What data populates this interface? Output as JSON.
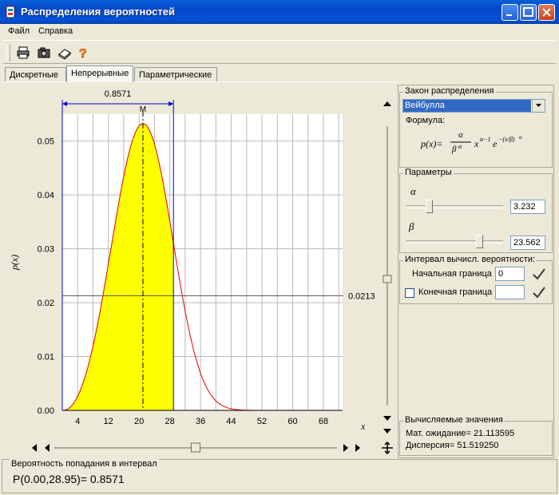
{
  "window": {
    "title": "Распределения вероятностей"
  },
  "menu": {
    "items": [
      "Файл",
      "Справка"
    ]
  },
  "toolbar": {
    "icons": [
      "printer-icon",
      "camera-icon",
      "book-icon",
      "help-icon"
    ]
  },
  "tabs": [
    {
      "label": "Дискретные",
      "active": false
    },
    {
      "label": "Непрерывные",
      "active": true
    },
    {
      "label": "Параметрические",
      "active": false
    }
  ],
  "chart": {
    "interval_width_label": "0.8571",
    "mode_label": "M",
    "ylabel": "p(x)",
    "xlabel": "x",
    "hline_label": "0.0213"
  },
  "chart_data": {
    "type": "area",
    "distribution": "weibull",
    "alpha": 3.232,
    "beta": 23.562,
    "xlim": [
      0,
      73
    ],
    "ylim": [
      0,
      0.055
    ],
    "xticks": [
      "4",
      "12",
      "20",
      "28",
      "36",
      "44",
      "52",
      "60",
      "68"
    ],
    "yticks": [
      "0.00",
      "0.01",
      "0.02",
      "0.03",
      "0.04",
      "0.05"
    ],
    "shaded_interval": [
      0.0,
      28.95
    ],
    "mode": 21.0,
    "mode_density": 0.0532,
    "hline_value": 0.0213,
    "grid": true
  },
  "panel": {
    "law_group_title": "Закон распределения",
    "law_selected": "Вейбулла",
    "formula_label": "Формула:",
    "params_group_title": "Параметры",
    "alpha_label": "α",
    "alpha_value": "3.232",
    "alpha_position": 0.22,
    "beta_label": "β",
    "beta_value": "23.562",
    "beta_position": 0.78,
    "interval_group_title": "Интервал вычисл. вероятности:",
    "start_label": "Начальная граница",
    "start_value": "0",
    "end_label": "Конечная граница",
    "end_value": "",
    "end_checked": false,
    "computed_group_title": "Вычисляемые значения",
    "mean_text": "Мат. ожидание= 21.113595",
    "variance_text": "Дисперсия= 51.519250"
  },
  "status": {
    "group_title": "Вероятность попадания в интервал",
    "result": "P(0.00,28.95)= 0.8571"
  },
  "scroll": {
    "vertical_position": 0.55,
    "horizontal_position": 0.5
  }
}
